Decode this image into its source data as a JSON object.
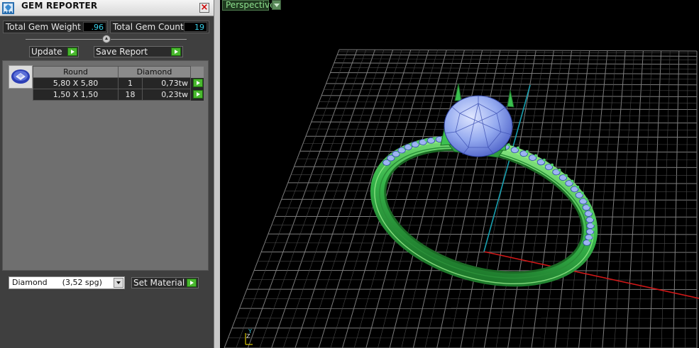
{
  "panel": {
    "title": "GEM REPORTER",
    "close_symbol": "×",
    "title_icon": "gem-reporter-icon",
    "stats": {
      "weight_label": "Total Gem Weight",
      "weight_value": ".96",
      "count_label": "Total Gem Count",
      "count_value": "19"
    },
    "buttons": {
      "update_label": "Update",
      "save_report_label": "Save Report",
      "set_material_label": "Set Material"
    },
    "gem_table": {
      "headers": [
        "Round",
        "Diamond"
      ],
      "rows": [
        {
          "size": "5,80 X 5,80",
          "count": "1",
          "weight": "0,73tw"
        },
        {
          "size": "1,50 X 1,50",
          "count": "18",
          "weight": "0,23tw"
        }
      ]
    },
    "material": {
      "name": "Diamond",
      "density": "(3,52 spg)"
    }
  },
  "viewport": {
    "view_name": "Perspective",
    "axis_labels": {
      "y": "Y",
      "z": "Z"
    }
  },
  "colors": {
    "panel_bg": "#3f3f3f",
    "accent_green": "#49b82e",
    "value_cyan": "#38d0e8",
    "grid_line": "#8a8a8a",
    "ring_green": "#3fbf52",
    "gem_blue": "#8fa8ee",
    "axis_x": "#d01818",
    "axis_y": "#18a0b0"
  }
}
